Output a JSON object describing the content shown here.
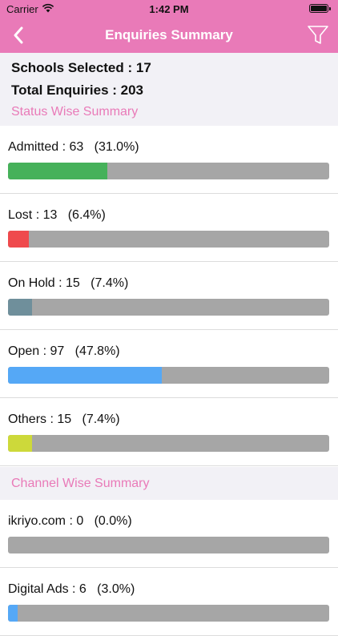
{
  "status_bar": {
    "carrier": "Carrier",
    "time": "1:42 PM"
  },
  "header": {
    "title": "Enquiries Summary",
    "back_icon": "chevron-left-icon",
    "filter_icon": "filter-icon"
  },
  "summary": {
    "schools_selected": "Schools Selected : 17",
    "total_enquiries": "Total Enquiries : 203"
  },
  "status_section": {
    "title": "Status Wise Summary",
    "items": [
      {
        "label": "Admitted : 63   (31.0%)",
        "percent": 31.0,
        "color": "#46b15a"
      },
      {
        "label": "Lost : 13   (6.4%)",
        "percent": 6.4,
        "color": "#ef4a4d"
      },
      {
        "label": "On Hold : 15   (7.4%)",
        "percent": 7.4,
        "color": "#6f8f9b"
      },
      {
        "label": "Open : 97   (47.8%)",
        "percent": 47.8,
        "color": "#55a8f6"
      },
      {
        "label": "Others : 15   (7.4%)",
        "percent": 7.4,
        "color": "#cdd93a"
      }
    ]
  },
  "channel_section": {
    "title": "Channel Wise Summary",
    "items": [
      {
        "label": "ikriyo.com : 0   (0.0%)",
        "percent": 0.0,
        "color": "#55a8f6"
      },
      {
        "label": "Digital Ads : 6   (3.0%)",
        "percent": 3.0,
        "color": "#55a8f6"
      }
    ]
  }
}
